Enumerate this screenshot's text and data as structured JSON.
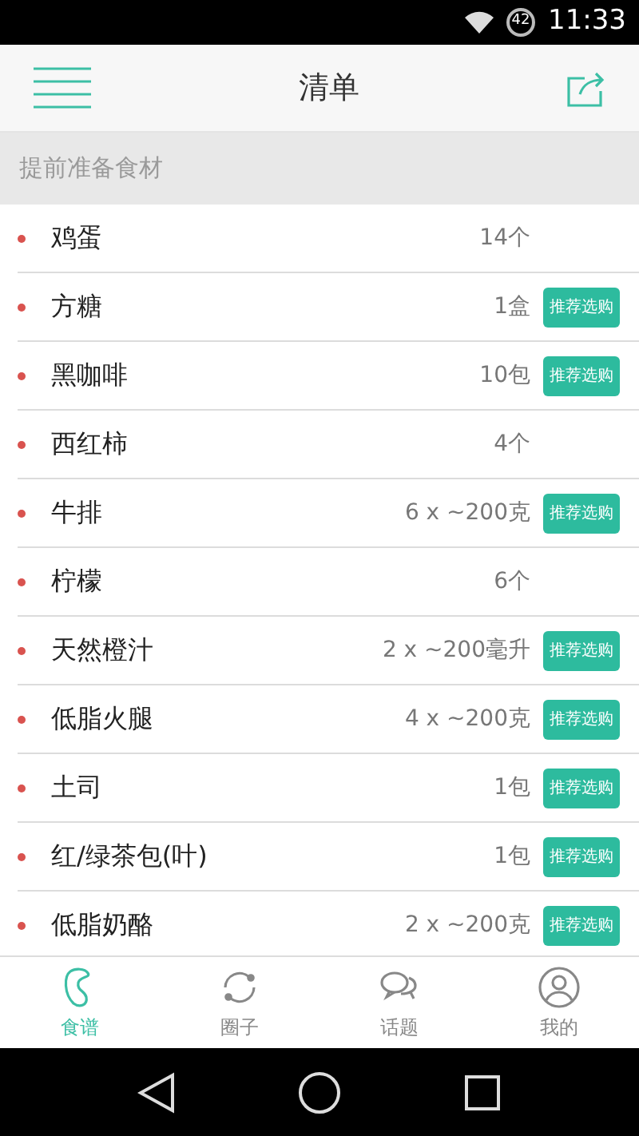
{
  "status_bar": {
    "battery": "42",
    "time": "11:33"
  },
  "header": {
    "title": "清单"
  },
  "section": {
    "title": "提前准备食材"
  },
  "items": [
    {
      "name": "鸡蛋",
      "amount": "14个"
    },
    {
      "name": "方糖",
      "amount": "1盒",
      "recommend": "推荐选购"
    },
    {
      "name": "黑咖啡",
      "amount": "10包",
      "recommend": "推荐选购"
    },
    {
      "name": "西红柿",
      "amount": "4个"
    },
    {
      "name": "牛排",
      "amount": "6 x ~200克",
      "recommend": "推荐选购"
    },
    {
      "name": "柠檬",
      "amount": "6个"
    },
    {
      "name": "天然橙汁",
      "amount": "2 x ~200毫升",
      "recommend": "推荐选购"
    },
    {
      "name": "低脂火腿",
      "amount": "4 x ~200克",
      "recommend": "推荐选购"
    },
    {
      "name": "土司",
      "amount": "1包",
      "recommend": "推荐选购"
    },
    {
      "name": "红/绿茶包(叶)",
      "amount": "1包",
      "recommend": "推荐选购"
    },
    {
      "name": "低脂奶酪",
      "amount": "2 x ~200克",
      "recommend": "推荐选购"
    }
  ],
  "tabs": [
    {
      "kind": "recipe",
      "label": "食谱",
      "selected": true
    },
    {
      "kind": "circle",
      "label": "圈子",
      "selected": false
    },
    {
      "kind": "topic",
      "label": "话题",
      "selected": false
    },
    {
      "kind": "profile",
      "label": "我的",
      "selected": false
    }
  ]
}
